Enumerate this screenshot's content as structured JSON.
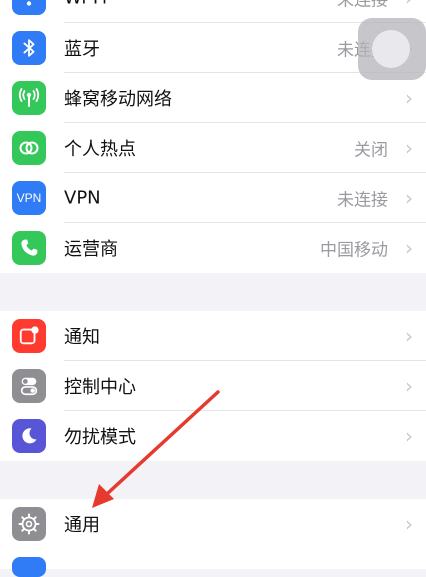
{
  "settings": {
    "group1": [
      {
        "label": "Wi-Fi",
        "value": "未连接",
        "icon": "wifi-icon",
        "color": "#2f7cf6"
      },
      {
        "label": "蓝牙",
        "value": "未连接",
        "icon": "bluetooth-icon",
        "color": "#2f7cf6"
      },
      {
        "label": "蜂窝移动网络",
        "value": "",
        "icon": "cellular-icon",
        "color": "#34c759"
      },
      {
        "label": "个人热点",
        "value": "关闭",
        "icon": "hotspot-icon",
        "color": "#34c759"
      },
      {
        "label": "VPN",
        "value": "未连接",
        "icon": "vpn-icon",
        "icon_text": "VPN",
        "color": "#2f7cf6"
      },
      {
        "label": "运营商",
        "value": "中国移动",
        "icon": "phone-icon",
        "color": "#34c759"
      }
    ],
    "group2": [
      {
        "label": "通知",
        "icon": "notification-icon",
        "color": "#ff3b30"
      },
      {
        "label": "控制中心",
        "icon": "control-center-icon",
        "color": "#8e8e93"
      },
      {
        "label": "勿扰模式",
        "icon": "moon-icon",
        "color": "#5856d6"
      }
    ],
    "group3": [
      {
        "label": "通用",
        "icon": "gear-icon",
        "color": "#8e8e93"
      }
    ]
  },
  "overlay": {
    "arrow_color": "#e63a2e"
  }
}
